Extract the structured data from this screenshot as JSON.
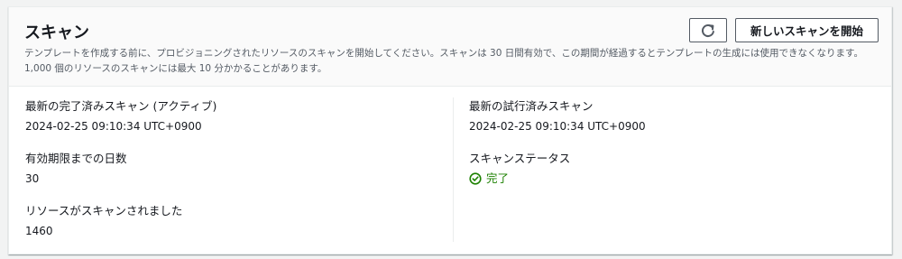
{
  "header": {
    "title": "スキャン",
    "description": "テンプレートを作成する前に、プロビジョニングされたリソースのスキャンを開始してください。スキャンは 30 日間有効で、この期間が経過するとテンプレートの生成には使用できなくなります。1,000 個のリソースのスキャンには最大 10 分かかることがあります。",
    "refresh_icon": "refresh-icon",
    "start_scan_label": "新しいスキャンを開始"
  },
  "left_column": {
    "latest_completed_label": "最新の完了済みスキャン (アクティブ)",
    "latest_completed_value": "2024-02-25 09:10:34 UTC+0900",
    "days_until_expiry_label": "有効期限までの日数",
    "days_until_expiry_value": "30",
    "resources_scanned_label": "リソースがスキャンされました",
    "resources_scanned_value": "1460"
  },
  "right_column": {
    "latest_attempted_label": "最新の試行済みスキャン",
    "latest_attempted_value": "2024-02-25 09:10:34 UTC+0900",
    "scan_status_label": "スキャンステータス",
    "scan_status_value": "完了",
    "status_icon": "success-check-icon"
  },
  "colors": {
    "success": "#1d8102",
    "text": "#16191f",
    "secondary_text": "#545b64"
  }
}
